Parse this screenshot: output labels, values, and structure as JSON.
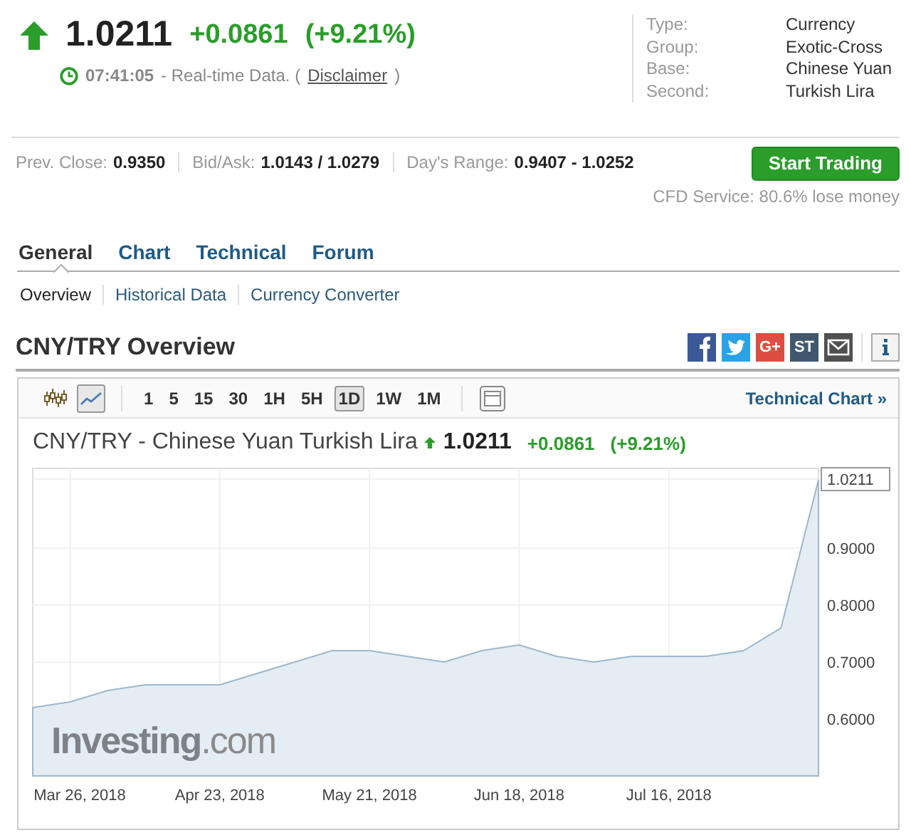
{
  "quote": {
    "rising": true,
    "price": "1.0211",
    "change": "+0.0861",
    "change_pct": "(+9.21%)",
    "time": "07:41:05",
    "realtime": "- Real-time Data. (",
    "disclaimer": "Disclaimer",
    "close_paren": ")"
  },
  "info": [
    {
      "label": "Type:",
      "value": "Currency"
    },
    {
      "label": "Group:",
      "value": "Exotic-Cross"
    },
    {
      "label": "Base:",
      "value": "Chinese Yuan"
    },
    {
      "label": "Second:",
      "value": "Turkish Lira"
    }
  ],
  "stats": [
    {
      "label": "Prev. Close:",
      "value": "0.9350"
    },
    {
      "label": "Bid/Ask:",
      "value": "1.0143 / 1.0279"
    },
    {
      "label": "Day's Range:",
      "value": "0.9407 - 1.0252"
    }
  ],
  "trade_button": "Start Trading",
  "cfd_note": "CFD Service: 80.6% lose money",
  "tabs": [
    {
      "label": "General",
      "selected": true
    },
    {
      "label": "Chart",
      "selected": false
    },
    {
      "label": "Technical",
      "selected": false
    },
    {
      "label": "Forum",
      "selected": false
    }
  ],
  "subtabs": [
    {
      "label": "Overview",
      "selected": true
    },
    {
      "label": "Historical Data",
      "selected": false
    },
    {
      "label": "Currency Converter",
      "selected": false
    }
  ],
  "section_title": "CNY/TRY Overview",
  "share_icons": [
    {
      "kind": "facebook"
    },
    {
      "kind": "twitter"
    },
    {
      "kind": "google",
      "text": "G+"
    },
    {
      "kind": "stocktwits",
      "text": "ST"
    },
    {
      "kind": "mail"
    },
    {
      "kind": "info"
    }
  ],
  "chart_panel": {
    "chart_types": [
      {
        "kind": "candles",
        "selected": false
      },
      {
        "kind": "line",
        "selected": true
      }
    ],
    "intervals": [
      {
        "label": "1",
        "selected": false
      },
      {
        "label": "5",
        "selected": false
      },
      {
        "label": "15",
        "selected": false
      },
      {
        "label": "30",
        "selected": false
      },
      {
        "label": "1H",
        "selected": false
      },
      {
        "label": "5H",
        "selected": false
      },
      {
        "label": "1D",
        "selected": true
      },
      {
        "label": "1W",
        "selected": false
      },
      {
        "label": "1M",
        "selected": false
      }
    ],
    "technical_link": "Technical Chart »",
    "instrument": "CNY/TRY - Chinese Yuan Turkish Lira",
    "rising": true,
    "price": "1.0211",
    "change": "+0.0861",
    "change_pct": "(+9.21%)",
    "logo": "**Investing**.com",
    "chart_data": {
      "type": "area",
      "categories": [
        null,
        "Mar 26, 2018",
        null,
        null,
        null,
        "Apr 23, 2018",
        null,
        null,
        null,
        "May 21, 2018",
        null,
        null,
        null,
        "Jun 18, 2018",
        null,
        null,
        null,
        "Jul 16, 2018",
        null,
        null,
        null,
        null
      ],
      "values": [
        0.62,
        0.63,
        0.65,
        0.66,
        0.66,
        0.66,
        0.68,
        0.7,
        0.72,
        0.72,
        0.71,
        0.7,
        0.72,
        0.73,
        0.71,
        0.7,
        0.71,
        0.71,
        0.71,
        0.72,
        0.76,
        1.02
      ],
      "ylim": [
        0.5,
        1.04
      ],
      "yticks": [
        {
          "value": 0.6,
          "label": "0.6000"
        },
        {
          "value": 0.7,
          "label": "0.7000"
        },
        {
          "value": 0.8,
          "label": "0.8000"
        },
        {
          "value": 0.9,
          "label": "0.9000"
        },
        {
          "value": 1.0211,
          "label": "1.0211"
        }
      ],
      "grid": true
    }
  }
}
